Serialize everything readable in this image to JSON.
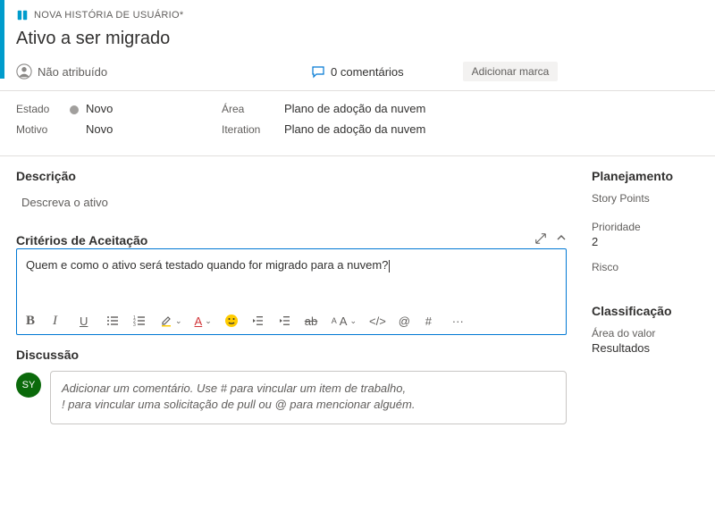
{
  "header": {
    "type_label": "NOVA HISTÓRIA DE USUÁRIO*",
    "title": "Ativo a ser migrado",
    "assignee": "Não atribuído",
    "comments_count": "0 comentários",
    "add_tag": "Adicionar marca"
  },
  "meta": {
    "state_label": "Estado",
    "state_value": "Novo",
    "area_label": "Área",
    "area_value": "Plano de adoção da nuvem",
    "reason_label": "Motivo",
    "reason_value": "Novo",
    "iteration_label": "Iteration",
    "iteration_value": "Plano de adoção da nuvem"
  },
  "sections": {
    "description_title": "Descrição",
    "description_placeholder": "Descreva o ativo",
    "acceptance_title": "Critérios de Aceitação",
    "acceptance_value": "Quem e como o ativo será testado quando for migrado para a nuvem?",
    "discussion_title": "Discussão",
    "discussion_placeholder": "Adicionar um comentário. Use # para vincular um item de trabalho,\n! para vincular uma solicitação de pull ou @ para mencionar alguém."
  },
  "avatar_initials": "SY",
  "sidebar": {
    "planning_title": "Planejamento",
    "story_points_label": "Story Points",
    "priority_label": "Prioridade",
    "priority_value": "2",
    "risk_label": "Risco",
    "classification_title": "Classificação",
    "value_area_label": "Área do valor",
    "value_area_value": "Resultados"
  },
  "toolbar": {
    "bold": "B",
    "italic": "I",
    "code": "</>",
    "mention": "@",
    "hash": "#",
    "ellipsis": "···"
  }
}
